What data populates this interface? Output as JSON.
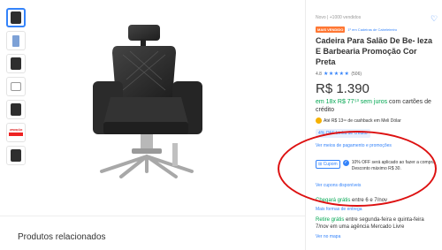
{
  "gallery": {
    "thumbnails": [
      {
        "icon": "chair-thumb-icon"
      },
      {
        "icon": "chair-side-thumb-icon"
      },
      {
        "icon": "chair-detail-thumb-icon"
      },
      {
        "icon": "chair-sketch-thumb-icon"
      },
      {
        "icon": "chair-back-thumb-icon"
      },
      {
        "label_1": "ATENÇÃO",
        "label_2": "",
        "label_3": ""
      },
      {
        "icon": "chair-base-thumb-icon"
      }
    ]
  },
  "related": {
    "title": "Produtos relacionados"
  },
  "product": {
    "condition": "Novo  |  +1000 vendidos",
    "badge": "MAIS VENDIDO",
    "rank": "1º em Cadeiras de Cabeleireiro",
    "title": "Cadeira Para Salão De Be- leza E Barbearia Promoção Cor Preta",
    "rating_value": "4.8",
    "stars": "★★★★★",
    "rating_count": "(506)",
    "price": "R$ 1.390",
    "installments_green": "em 18x R$ 77⁵³ sem juros",
    "installments_rest": " com cartões de crédito",
    "cashback": "Até R$ 13¹⁹ de cashback em Meli Dólar",
    "credit_offer": "4% OFF Linha de crédito",
    "payment_link": "Ver meios de pagamento e promoções",
    "coupon_tag": "Cupom",
    "coupon_text": "10% OFF será aplicado ao fazer a compra. Desconto máximo R$ 30.",
    "coupon_link": "Ver cupons disponíveis",
    "shipping_green": "Chegará grátis",
    "shipping_rest": " entre 6 e 7/nov",
    "shipping_link": "Mais formas de entrega",
    "pickup_green": "Retire grátis",
    "pickup_rest": " entre segunda-feira e quinta-feira 7/nov em uma agência Mercado Livre",
    "map_link": "Ver no mapa"
  },
  "colors": {
    "accent": "#3483fa",
    "green": "#00a650",
    "badge": "#ff7733",
    "annotation": "#dd1111"
  }
}
